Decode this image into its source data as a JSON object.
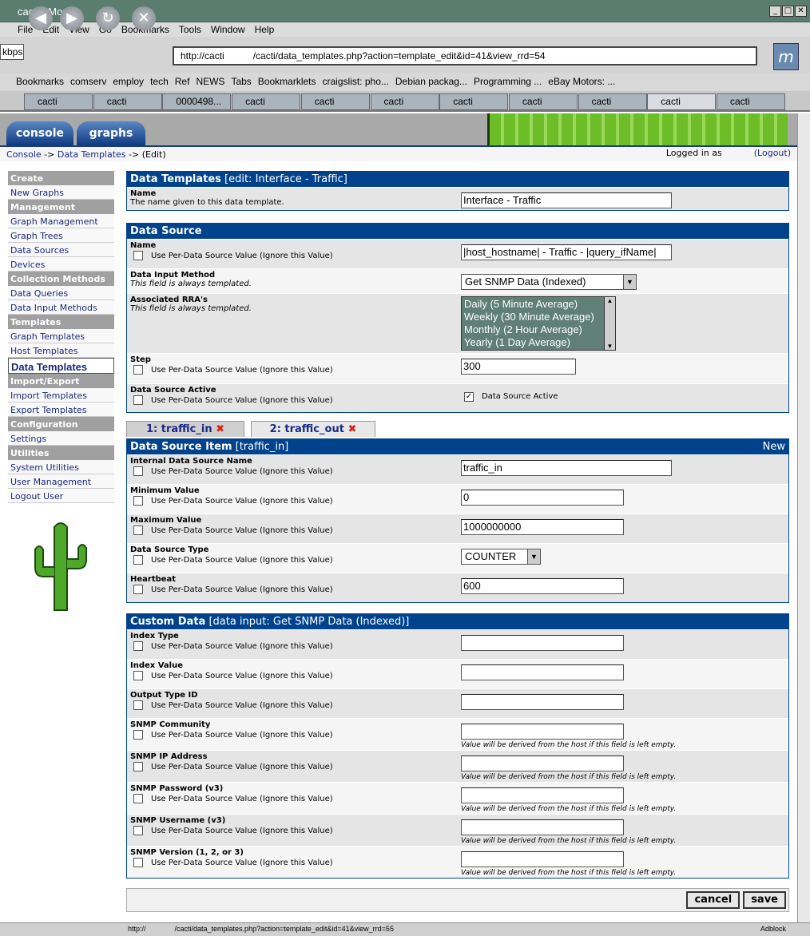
{
  "browser": {
    "title": "cacti - Mozilla",
    "menu": [
      "File",
      "Edit",
      "View",
      "Go",
      "Bookmarks",
      "Tools",
      "Window",
      "Help"
    ],
    "kbps": "kbps",
    "url": "http://cacti   /cacti/data_templates.php?action=template_edit&id=41&view_rrd=54",
    "bookmarks": [
      "Bookmarks",
      "comserv",
      "employ",
      "tech",
      "Ref",
      "NEWS",
      "Tabs",
      "Bookmarklets",
      "craigslist: pho...",
      "Debian packag...",
      "Programming ...",
      "eBay Motors: ..."
    ],
    "tabs": [
      "cacti",
      "cacti",
      "0000498...",
      "cacti",
      "cacti",
      "cacti",
      "cacti",
      "cacti",
      "cacti",
      "cacti",
      "cacti"
    ],
    "active_tab": 9,
    "status_url": "http://    /cacti/data_templates.php?action=template_edit&id=41&view_rrd=55",
    "status_right": "Adblock"
  },
  "nav": {
    "console": "console",
    "graphs": "graphs"
  },
  "breadcrumb": {
    "console": "Console",
    "sep1": " -> ",
    "data_templates": "Data Templates",
    "sep2": " -> (Edit)"
  },
  "login": {
    "prefix": "Logged in as",
    "user": "   ",
    "logout": "(Logout)"
  },
  "sidebar": [
    {
      "h": "Create"
    },
    {
      "i": "New Graphs"
    },
    {
      "h": "Management"
    },
    {
      "i": "Graph Management"
    },
    {
      "i": "Graph Trees"
    },
    {
      "i": "Data Sources"
    },
    {
      "i": "Devices"
    },
    {
      "h": "Collection Methods"
    },
    {
      "i": "Data Queries"
    },
    {
      "i": "Data Input Methods"
    },
    {
      "h": "Templates"
    },
    {
      "i": "Graph Templates"
    },
    {
      "i": "Host Templates"
    },
    {
      "i": "Data Templates",
      "sel": true
    },
    {
      "h": "Import/Export"
    },
    {
      "i": "Import Templates"
    },
    {
      "i": "Export Templates"
    },
    {
      "h": "Configuration"
    },
    {
      "i": "Settings"
    },
    {
      "h": "Utilities"
    },
    {
      "i": "System Utilities"
    },
    {
      "i": "User Management"
    },
    {
      "i": "Logout User"
    }
  ],
  "per_ds": "Use Per-Data Source Value (Ignore this Value)",
  "hint_host": "Value will be derived from the host if this field is left empty.",
  "box1": {
    "title": "Data Templates",
    "sub": " [edit: Interface - Traffic]",
    "rows": [
      {
        "t": "Name",
        "d": "The name given to this data template.",
        "type": "text",
        "v": "Interface - Traffic",
        "w": 264,
        "h": 29
      }
    ]
  },
  "box2": {
    "title": "Data Source",
    "sub": "",
    "rows": [
      {
        "t": "Name",
        "chk": true,
        "type": "text",
        "v": "|host_hostname| - Traffic - |query_ifName|",
        "w": 264,
        "h": 37
      },
      {
        "t": "Data Input Method",
        "d": "This field is always templated.",
        "italic": true,
        "type": "select",
        "v": "Get SNMP Data (Indexed)",
        "w": 220,
        "h": 31
      },
      {
        "t": "Associated RRA's",
        "d": "This field is always templated.",
        "italic": true,
        "type": "list",
        "opts": [
          "Daily (5 Minute Average)",
          "Weekly (30 Minute Average)",
          "Monthly (2 Hour Average)",
          "Yearly (1 Day Average)"
        ],
        "h": 75
      },
      {
        "t": "Step",
        "chk": true,
        "type": "text",
        "v": "300",
        "w": 144,
        "h": 38
      },
      {
        "t": "Data Source Active",
        "chk": true,
        "type": "check",
        "v": "Data Source Active",
        "checked": true,
        "h": 36
      }
    ]
  },
  "ds_tabs": [
    {
      "label": "1: traffic_in",
      "close": "✖"
    },
    {
      "label": "2: traffic_out",
      "close": "✖"
    }
  ],
  "box3": {
    "title": "Data Source Item",
    "sub": " [traffic_in]",
    "right": "New",
    "rows": [
      {
        "t": "Internal Data Source Name",
        "chk": true,
        "type": "text",
        "v": "traffic_in",
        "w": 264,
        "h": 37
      },
      {
        "t": "Minimum Value",
        "chk": true,
        "type": "text",
        "v": "0",
        "w": 204,
        "h": 37
      },
      {
        "t": "Maximum Value",
        "chk": true,
        "type": "text",
        "v": "1000000000",
        "w": 204,
        "h": 37
      },
      {
        "t": "Data Source Type",
        "chk": true,
        "type": "select",
        "v": "COUNTER",
        "w": 100,
        "h": 37
      },
      {
        "t": "Heartbeat",
        "chk": true,
        "type": "text",
        "v": "600",
        "w": 204,
        "h": 37
      }
    ]
  },
  "box4": {
    "title": "Custom Data",
    "sub": " [data input: Get SNMP Data (Indexed)]",
    "rows": [
      {
        "t": "Index Type",
        "chk": true,
        "type": "text",
        "v": "",
        "w": 204,
        "h": 37
      },
      {
        "t": "Index Value",
        "chk": true,
        "type": "text",
        "v": "",
        "w": 204,
        "h": 37
      },
      {
        "t": "Output Type ID",
        "chk": true,
        "type": "text",
        "v": "",
        "w": 204,
        "h": 37
      },
      {
        "t": "SNMP Community",
        "chk": true,
        "type": "text",
        "v": "",
        "w": 204,
        "hint": true,
        "h": 40
      },
      {
        "t": "SNMP IP Address",
        "chk": true,
        "type": "text",
        "v": "",
        "w": 204,
        "hint": true,
        "h": 40
      },
      {
        "t": "SNMP Password (v3)",
        "chk": true,
        "type": "text",
        "v": "",
        "w": 204,
        "hint": true,
        "h": 40
      },
      {
        "t": "SNMP Username (v3)",
        "chk": true,
        "type": "text",
        "v": "",
        "w": 204,
        "hint": true,
        "h": 40
      },
      {
        "t": "SNMP Version (1, 2, or 3)",
        "chk": true,
        "type": "text",
        "v": "",
        "w": 204,
        "hint": true,
        "h": 40
      }
    ]
  },
  "buttons": {
    "cancel": "cancel",
    "save": "save"
  },
  "colors": {
    "header_blue": "#00438c",
    "sidebar_header": "#a0a0a0",
    "link": "#1a2a8a",
    "tab_close": "#e02010"
  }
}
